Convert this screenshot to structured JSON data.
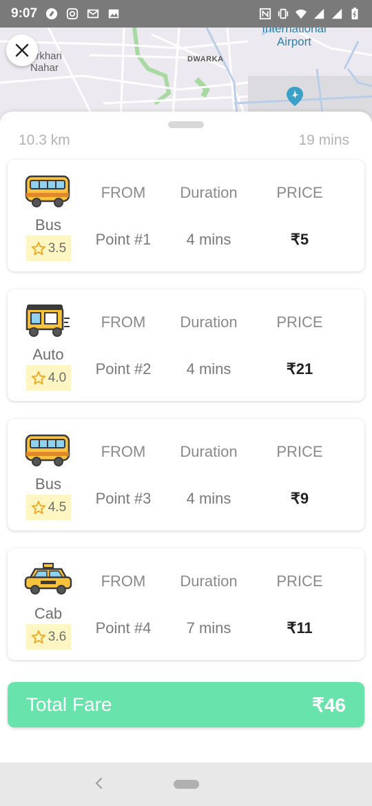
{
  "status_bar": {
    "time": "9:07",
    "left_icons": [
      "shazam-icon",
      "instagram-icon",
      "gmail-icon",
      "gallery-icon"
    ],
    "right_icons": [
      "nfc-icon",
      "vibrate-icon",
      "wifi-icon",
      "signal-icon",
      "signal-icon",
      "battery-icon"
    ]
  },
  "map": {
    "label_top_left_line1": "arkhari",
    "label_top_left_line2": "Nahar",
    "label_dwarka": "DWARKA",
    "label_airport_line1": "International",
    "label_airport_line2": "Airport"
  },
  "summary": {
    "distance": "10.3 km",
    "time": "19 mins"
  },
  "column_headers": {
    "from": "FROM",
    "duration": "Duration",
    "price": "PRICE"
  },
  "legs": [
    {
      "vehicle": "Bus",
      "icon": "bus-icon",
      "rating": "3.5",
      "from": "Point #1",
      "duration": "4 mins",
      "price": "₹5"
    },
    {
      "vehicle": "Auto",
      "icon": "auto-rickshaw-icon",
      "rating": "4.0",
      "from": "Point #2",
      "duration": "4 mins",
      "price": "₹21"
    },
    {
      "vehicle": "Bus",
      "icon": "bus-icon",
      "rating": "4.5",
      "from": "Point #3",
      "duration": "4 mins",
      "price": "₹9"
    },
    {
      "vehicle": "Cab",
      "icon": "cab-icon",
      "rating": "3.6",
      "from": "Point #4",
      "duration": "7 mins",
      "price": "₹11"
    }
  ],
  "total": {
    "label": "Total Fare",
    "value": "₹46"
  },
  "colors": {
    "accent": "#69e3ac",
    "rating_bg": "#fdf6c3",
    "star": "#f2a61f",
    "vehicle_yellow": "#f9c23c"
  }
}
